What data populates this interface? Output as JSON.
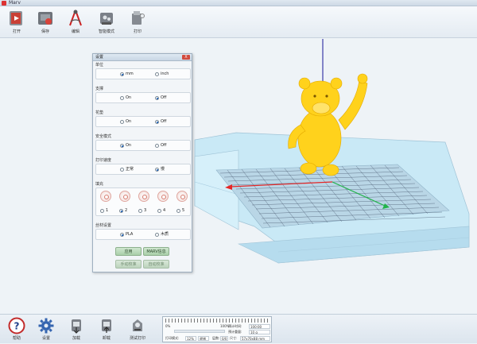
{
  "window": {
    "title": "Marv"
  },
  "toolbar": {
    "items": [
      {
        "label": "打开",
        "icon": "open-file-icon"
      },
      {
        "label": "保存",
        "icon": "save-icon"
      },
      {
        "label": "编辑",
        "icon": "edit-compass-icon"
      },
      {
        "label": "智能模式",
        "icon": "smart-mode-icon"
      },
      {
        "label": "打印",
        "icon": "print-icon"
      }
    ]
  },
  "settings": {
    "title": "设置",
    "close_label": "X",
    "unit": {
      "caption": "单位",
      "options": [
        "mm",
        "inch"
      ],
      "selected": 0
    },
    "support": {
      "caption": "支撑",
      "options": [
        "On",
        "Off"
      ],
      "selected": 1
    },
    "raft": {
      "caption": "花垫",
      "options": [
        "On",
        "Off"
      ],
      "selected": 1
    },
    "safe_mode": {
      "caption": "安全模式",
      "options": [
        "On",
        "Off"
      ],
      "selected": 0
    },
    "print_speed": {
      "caption": "打印速度",
      "options": [
        "正常",
        "慢"
      ],
      "selected": 1
    },
    "orientation": {
      "caption": "填充",
      "options": [
        "1",
        "2",
        "3",
        "4",
        "5"
      ],
      "selected": 1
    },
    "material": {
      "caption": "丝材设置",
      "options": [
        "PLA",
        "木质"
      ],
      "selected": 0
    },
    "buttons": {
      "apply": "应用",
      "marv_info": "MARV信息",
      "manual_calibrate": "手动校准",
      "auto_calibrate": "自动校准"
    }
  },
  "bottombar": {
    "items": [
      {
        "label": "帮助",
        "icon": "help-icon"
      },
      {
        "label": "设置",
        "icon": "gear-icon"
      },
      {
        "label": "加载",
        "icon": "load-filament-icon"
      },
      {
        "label": "卸载",
        "icon": "unload-filament-icon"
      },
      {
        "label": "测试打印",
        "icon": "test-print-icon"
      }
    ]
  },
  "status": {
    "progress_left": "0%",
    "progress_right": "100%",
    "progress_fraction": 0.0,
    "label1": "预计时间:",
    "value1": "100:00",
    "label2": "预计重量:",
    "value2": "10 g",
    "label3": "层数:",
    "value3": "0/0",
    "mode_label": "打印模式:",
    "mode_value": "12%",
    "state_value": "就绪",
    "size_label": "尺寸:",
    "size_value": "57x70x88 mm"
  },
  "colors": {
    "bear": "#ffd21c",
    "platform": "#c9e9f6",
    "grid": "#3f4f66",
    "axis_x": "#e62626",
    "axis_y": "#21b34a",
    "axis_z": "#3a3aa8"
  }
}
